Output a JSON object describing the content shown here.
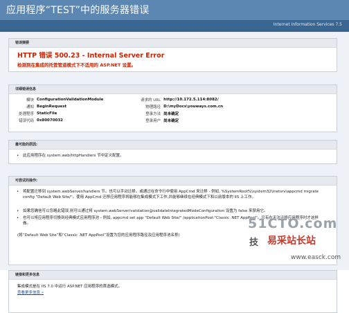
{
  "header": {
    "title": "应用程序“TEST”中的服务器错误",
    "product": "Internet Information Services 7.5"
  },
  "error_summary": {
    "heading": "错误摘要",
    "title": "HTTP 错误 500.23 - Internal Server Error",
    "description": "检测到在集成的托管管道模式下不适用的 ASP.NET 设置。"
  },
  "details": {
    "heading": "详细错误信息",
    "left": [
      {
        "k": "模块",
        "v": "ConfigurationValidationModule"
      },
      {
        "k": "通知",
        "v": "BeginRequest"
      },
      {
        "k": "处理程序",
        "v": "StaticFile"
      },
      {
        "k": "错误代码",
        "v": "0x80070032"
      }
    ],
    "right": [
      {
        "k": "请求的 URL",
        "v": "http://10.172.5.114:8082/"
      },
      {
        "k": "物理路径",
        "v": "D:\\myDocs\\youways.com.cn"
      },
      {
        "k": "登录方法",
        "v": "尚未确定"
      },
      {
        "k": "登录用户",
        "v": "尚未确定"
      }
    ]
  },
  "causes": {
    "heading": "最可能的原因:",
    "items": [
      "此应用程序在 system.web/httpHandlers 节中定义配置。"
    ]
  },
  "actions": {
    "heading": "可尝试的操作:",
    "items": [
      "将配置迁移到 system.webServer/handlers 节。也可以手动迁移。或通过在命令行中使用 AppCmd 来迁移 - 例如, %SystemRoot%\\system32\\inetsrv\\appcmd migrate config \"Default Web Site/\"。使用 AppCmd 迁移应用程序将能够在集成模式下工作,并能够继续在经典模式下和以前版本的 IIS 上工作。",
      "如果您确信可以忽略此错误,则可以通过将 system.webServer/validation@validateIntegratedModeConfiguration 设置为 false 来禁用它。",
      "也可以将应用程序切换到经典模式应用程序池 - 例如, appcmd set app \"Default Web Site/\" /applicationPool:\"Classic .NET AppPool\"。只有在无法迁移应用程序时才这样做。"
    ],
    "footnote": "(将“Default Web Site”和“Classic .NET AppPool”设置为您的应用程序路径及应用程序池名称)"
  },
  "links": {
    "heading": "链接和更多信息",
    "text": "集成模式是在 IIS 7.0 中运行 ASP.NET 应用程序的首选模式。",
    "more": "查看更多信息 »"
  },
  "watermark": {
    "brand": "51CTO.com",
    "prefix": "技",
    "site": "易采站长站",
    "url": "www.easck.com"
  }
}
